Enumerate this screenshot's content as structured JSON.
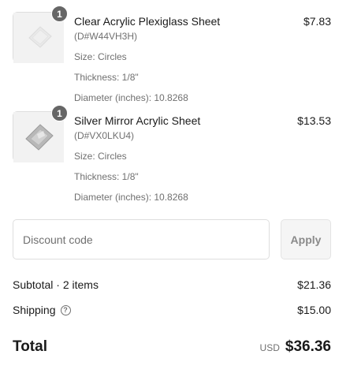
{
  "items": [
    {
      "quantity": "1",
      "name": "Clear Acrylic Plexiglass Sheet",
      "sku": "(D#W44VH3H)",
      "size": "Size: Circles",
      "thickness": "Thickness: 1/8\"",
      "diameter": "Diameter (inches): 10.8268",
      "price": "$7.83",
      "image_icon": "clear-acrylic-sheet-image"
    },
    {
      "quantity": "1",
      "name": "Silver Mirror Acrylic Sheet",
      "sku": "(D#VX0LKU4)",
      "size": "Size: Circles",
      "thickness": "Thickness: 1/8\"",
      "diameter": "Diameter (inches): 10.8268",
      "price": "$13.53",
      "image_icon": "mirror-acrylic-sheet-image"
    }
  ],
  "discount": {
    "placeholder": "Discount code",
    "value": "",
    "apply_label": "Apply"
  },
  "summary": {
    "subtotal_label": "Subtotal · 2 items",
    "subtotal_value": "$21.36",
    "shipping_label": "Shipping",
    "shipping_help_icon": "question-circle-icon",
    "shipping_value": "$15.00",
    "total_label": "Total",
    "currency": "USD",
    "total_value": "$36.36"
  },
  "colors": {
    "badge": "#666666",
    "muted_text": "#707070",
    "border": "#dedede"
  }
}
